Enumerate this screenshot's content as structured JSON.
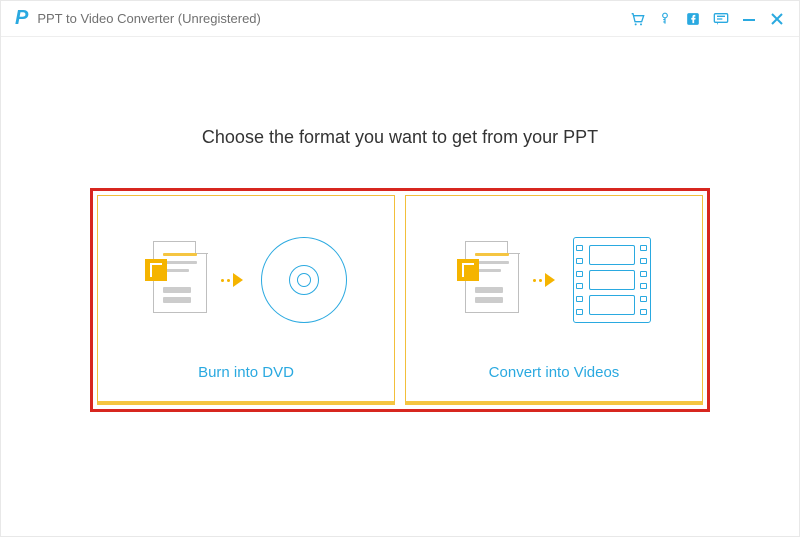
{
  "titlebar": {
    "app_title": "PPT to Video Converter (Unregistered)"
  },
  "main": {
    "heading": "Choose the format you want to get from your PPT",
    "options": {
      "burn_dvd": "Burn into DVD",
      "convert_videos": "Convert into Videos"
    }
  },
  "icons": {
    "cart": "cart-icon",
    "key": "key-icon",
    "facebook": "facebook-icon",
    "feedback": "feedback-icon",
    "minimize": "minimize-icon",
    "close": "close-icon"
  },
  "colors": {
    "accent": "#2aa9e0",
    "highlight": "#f5b400",
    "annotation": "#d7261f"
  }
}
